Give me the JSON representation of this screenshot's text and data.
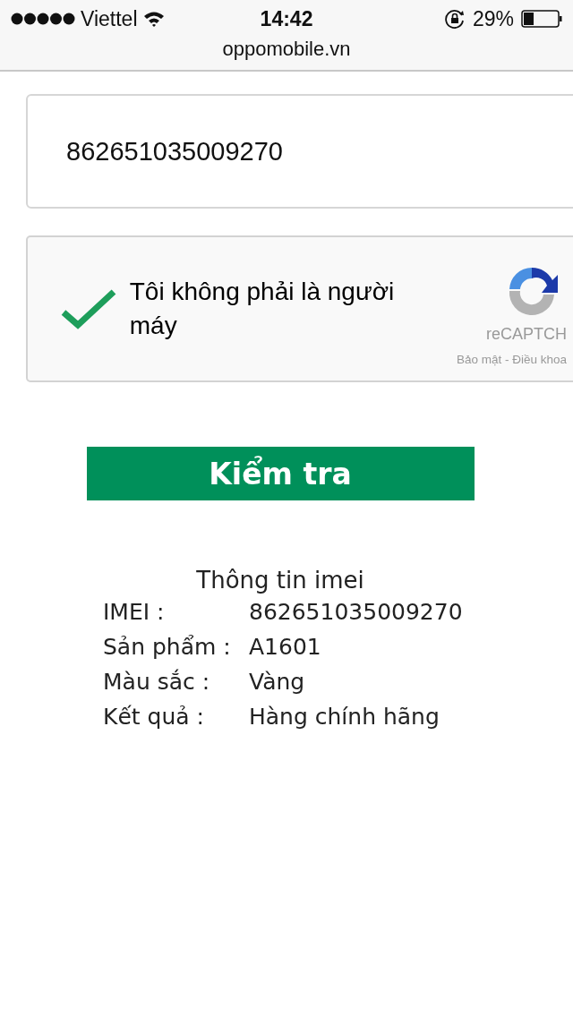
{
  "status_bar": {
    "carrier": "Viettel",
    "time": "14:42",
    "battery": "29%"
  },
  "address_bar": {
    "url": "oppomobile.vn"
  },
  "imei_field": {
    "value": "862651035009270"
  },
  "captcha": {
    "checked": true,
    "label": "Tôi không phải là người máy",
    "brand": "reCAPTCH",
    "links": "Bảo mật - Điều khoa"
  },
  "check_button": {
    "label": "Kiểm tra"
  },
  "info": {
    "title": "Thông tin imei",
    "rows": [
      {
        "label": "IMEI :",
        "value": "862651035009270"
      },
      {
        "label": "Sản phẩm :",
        "value": "A1601"
      },
      {
        "label": "Màu sắc :",
        "value": "Vàng"
      },
      {
        "label": "Kết quả :",
        "value": "Hàng chính hãng"
      }
    ]
  }
}
